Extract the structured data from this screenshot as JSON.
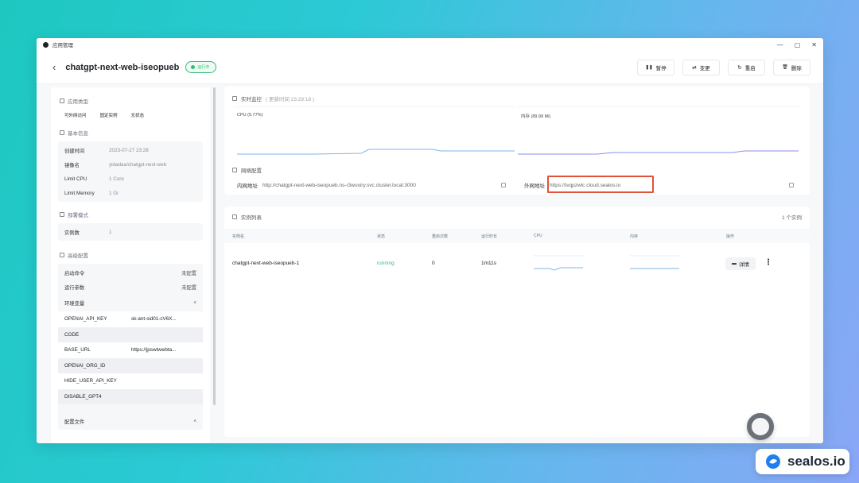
{
  "window": {
    "title": "应用管理",
    "controls": [
      "—",
      "▢",
      "✕"
    ]
  },
  "header": {
    "back_glyph": "‹",
    "app_name": "chatgpt-next-web-iseopueb",
    "status": "运行中",
    "actions": [
      {
        "icon": "pause-icon",
        "glyph": "❚❚",
        "label": "暂停"
      },
      {
        "icon": "swap-icon",
        "glyph": "⇄",
        "label": "变更"
      },
      {
        "icon": "restart-icon",
        "glyph": "↻",
        "label": "重启"
      },
      {
        "icon": "trash-icon",
        "glyph": "🗑",
        "label": "删除"
      }
    ]
  },
  "sidebar": {
    "app_type_title": "应用类型",
    "app_type_tags": [
      "可外网访问",
      "固定实例",
      "无状态"
    ],
    "basic_title": "基本信息",
    "basic": [
      {
        "key": "创建时间",
        "value": "2023-07-27 23:28"
      },
      {
        "key": "镜像名",
        "value": "yidadaa/chatgpt-next-web"
      },
      {
        "key": "Limit CPU",
        "value": "1 Core"
      },
      {
        "key": "Limit Memory",
        "value": "1 Gi"
      }
    ],
    "deploy_title": "部署模式",
    "deploy": {
      "key": "实例数",
      "value": "1"
    },
    "advanced_title": "高级配置",
    "advanced": [
      {
        "key": "启动命令",
        "value": "未配置"
      },
      {
        "key": "运行参数",
        "value": "未配置"
      }
    ],
    "env_title": "环境变量",
    "env_toggle": "˄",
    "env": [
      {
        "key": "OPENAI_API_KEY",
        "value": "sk-ant-sid01-cV6X..."
      },
      {
        "key": "CODE",
        "value": ""
      },
      {
        "key": "BASE_URL",
        "value": "https://jpswtwwbta..."
      },
      {
        "key": "OPENAI_ORG_ID",
        "value": ""
      },
      {
        "key": "HIDE_USER_API_KEY",
        "value": ""
      },
      {
        "key": "DISABLE_GPT4",
        "value": ""
      }
    ],
    "config_title": "配置文件",
    "config_toggle": "˄"
  },
  "monitor": {
    "title": "实时监控",
    "updated": "( 更新时间 23:29:18 )",
    "cpu_label": "CPU (5.77%)",
    "mem_label": "内存 (89.99 Mi)"
  },
  "network": {
    "title": "网络配置",
    "internal_key": "内网地址",
    "internal_value": "http://chatgpt-next-web-iseopueb.ns-r3woxiry.svc.cluster.local:3000",
    "external_key": "外网地址",
    "external_value": "https://tvqpzwlc.cloud.sealos.io"
  },
  "instances": {
    "title": "实例列表",
    "count": "1 个实例",
    "columns": [
      "实例名",
      "状态",
      "重启次数",
      "运行时长",
      "CPU",
      "内存",
      "操作"
    ],
    "rows": [
      {
        "name": "chatgpt-next-web-iseopueb-1",
        "status": "running",
        "restarts": "0",
        "uptime": "1m11s",
        "detail_label": "详情",
        "more": "⋮"
      }
    ]
  },
  "colors": {
    "running": "#2fbf71",
    "highlight": "#e1523a",
    "cpu_line": "#7fb6e8",
    "mem_line": "#8b8fe8"
  },
  "brand": {
    "name": "sealos.io"
  }
}
